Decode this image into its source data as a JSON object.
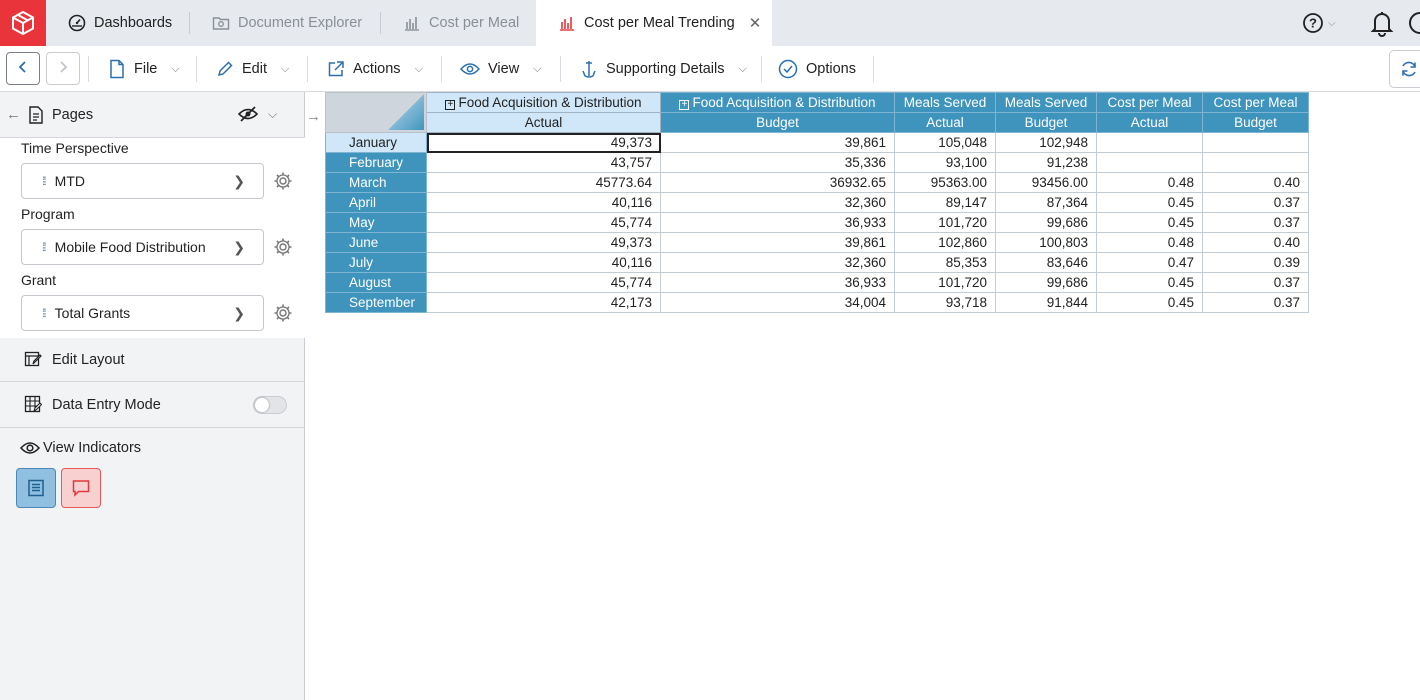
{
  "tabs": {
    "dashboards": "Dashboards",
    "document_explorer": "Document Explorer",
    "cost_per_meal": "Cost per Meal",
    "cost_per_meal_trending": "Cost per Meal Trending"
  },
  "toolbar": {
    "file": "File",
    "edit": "Edit",
    "actions": "Actions",
    "view": "View",
    "supporting_details": "Supporting Details",
    "options": "Options"
  },
  "sidebar": {
    "pages_label": "Pages",
    "filters": [
      {
        "label": "Time Perspective",
        "value": "MTD"
      },
      {
        "label": "Program",
        "value": "Mobile Food Distribution"
      },
      {
        "label": "Grant",
        "value": "Total Grants"
      }
    ],
    "edit_layout": "Edit Layout",
    "data_entry_mode": "Data Entry Mode",
    "view_indicators": "View Indicators"
  },
  "grid": {
    "col_headers_top": [
      "Food Acquisition & Distribution",
      "Food Acquisition & Distribution",
      "Meals Served",
      "Meals Served",
      "Cost per Meal",
      "Cost per Meal"
    ],
    "col_headers_sub": [
      "Actual",
      "Budget",
      "Actual",
      "Budget",
      "Actual",
      "Budget"
    ],
    "rows": [
      {
        "month": "January",
        "cells": [
          "49,373",
          "39,861",
          "105,048",
          "102,948",
          "",
          ""
        ]
      },
      {
        "month": "February",
        "cells": [
          "43,757",
          "35,336",
          "93,100",
          "91,238",
          "",
          ""
        ]
      },
      {
        "month": "March",
        "cells": [
          "45773.64",
          "36932.65",
          "95363.00",
          "93456.00",
          "0.48",
          "0.40"
        ]
      },
      {
        "month": "April",
        "cells": [
          "40,116",
          "32,360",
          "89,147",
          "87,364",
          "0.45",
          "0.37"
        ]
      },
      {
        "month": "May",
        "cells": [
          "45,774",
          "36,933",
          "101,720",
          "99,686",
          "0.45",
          "0.37"
        ]
      },
      {
        "month": "June",
        "cells": [
          "49,373",
          "39,861",
          "102,860",
          "100,803",
          "0.48",
          "0.40"
        ]
      },
      {
        "month": "July",
        "cells": [
          "40,116",
          "32,360",
          "85,353",
          "83,646",
          "0.47",
          "0.39"
        ]
      },
      {
        "month": "August",
        "cells": [
          "45,774",
          "36,933",
          "101,720",
          "99,686",
          "0.45",
          "0.37"
        ]
      },
      {
        "month": "September",
        "cells": [
          "42,173",
          "34,004",
          "93,718",
          "91,844",
          "0.45",
          "0.37"
        ]
      }
    ]
  },
  "colors": {
    "brand": "#e8343a",
    "header_blue": "#3f94bd",
    "header_light": "#cfe7f8"
  }
}
